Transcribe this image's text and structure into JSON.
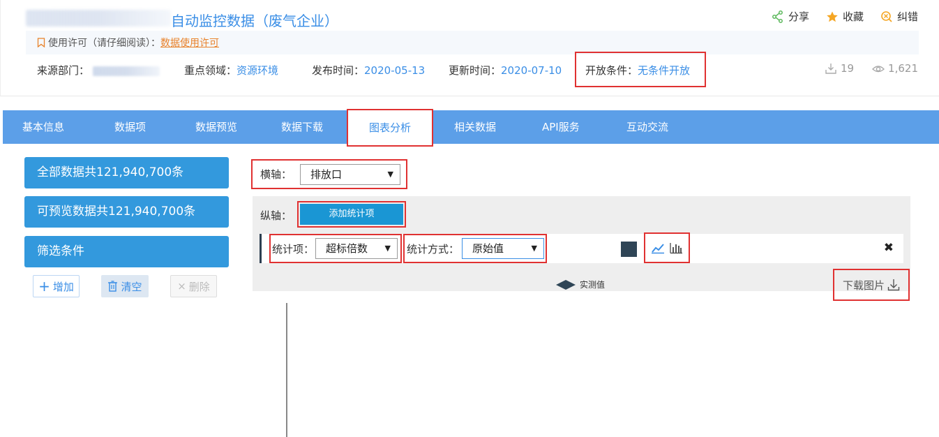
{
  "header": {
    "title": "自动监控数据（废气企业）",
    "actions": {
      "share": "分享",
      "favorite": "收藏",
      "report": "纠错"
    },
    "license": {
      "prefix": "使用许可（请仔细阅读）：",
      "link": "数据使用许可"
    },
    "meta": {
      "source_label": "来源部门：",
      "domain_label": "重点领域：",
      "domain_value": "资源环境",
      "published_label": "发布时间：",
      "published_value": "2020-05-13",
      "updated_label": "更新时间：",
      "updated_value": "2020-07-10",
      "open_label": "开放条件：",
      "open_value": "无条件开放"
    },
    "stats": {
      "downloads": "19",
      "views": "1,621"
    }
  },
  "tabs": [
    "基本信息",
    "数据项",
    "数据预览",
    "数据下载",
    "图表分析",
    "相关数据",
    "API服务",
    "互动交流"
  ],
  "active_tab": "图表分析",
  "left_panel": {
    "total": "全部数据共121,940,700条",
    "previewable": "可预览数据共121,940,700条",
    "filter": "筛选条件",
    "add": "增加",
    "clear": "清空",
    "delete": "删除"
  },
  "chart_config": {
    "x_axis_label": "横轴：",
    "x_axis_value": "排放口",
    "y_axis_label": "纵轴：",
    "add_stat_button": "添加统计项",
    "stat_item_label": "统计项：",
    "stat_item_value": "超标倍数",
    "stat_method_label": "统计方式：",
    "stat_method_value": "原始值",
    "series_color": "#2f4556",
    "legend_label": "实测值",
    "download_image": "下载图片"
  },
  "colors": {
    "accent": "#3a8ee6",
    "tab_bar": "#5c9fe8",
    "highlight": "#e03131",
    "button": "#3399dd"
  }
}
